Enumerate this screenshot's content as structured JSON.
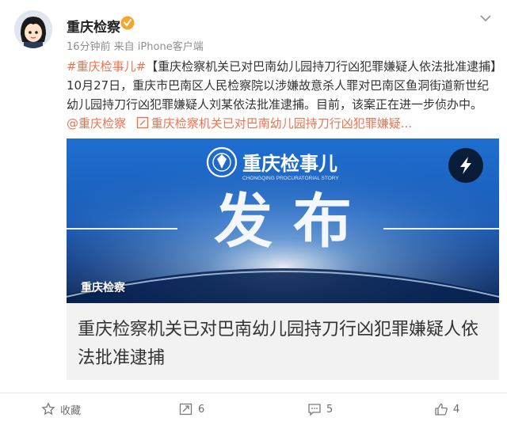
{
  "user": {
    "name": "重庆检察",
    "meta": "16分钟前  来自 iPhone客户端"
  },
  "post": {
    "hashtag": "#重庆检事儿#",
    "body": "【重庆检察机关已对巴南幼儿园持刀行凶犯罪嫌疑人依法批准逮捕】10月27日，重庆市巴南区人民检察院以涉嫌故意杀人罪对巴南区鱼洞街道新世纪幼儿园持刀行凶犯罪嫌疑人刘某依法批准逮捕。目前，该案正在进一步侦办中。",
    "mention": "@重庆检察",
    "link_text": "重庆检察机关已对巴南幼儿园持刀行凶犯罪嫌疑..."
  },
  "card": {
    "logo_title": "重庆检事儿",
    "logo_subtitle": "CHONGQING PROCURATORIAL STORY",
    "headline": "发 布",
    "source": "重庆检察",
    "title": "重庆检察机关已对巴南幼儿园持刀行凶犯罪嫌疑人依法批准逮捕"
  },
  "actions": {
    "favorite": "收藏",
    "repost_count": "6",
    "comment_count": "5",
    "like_count": "4"
  },
  "colors": {
    "link": "#eb7350",
    "verified": "#f8a42a",
    "card_bg": "#f2f2f2"
  }
}
